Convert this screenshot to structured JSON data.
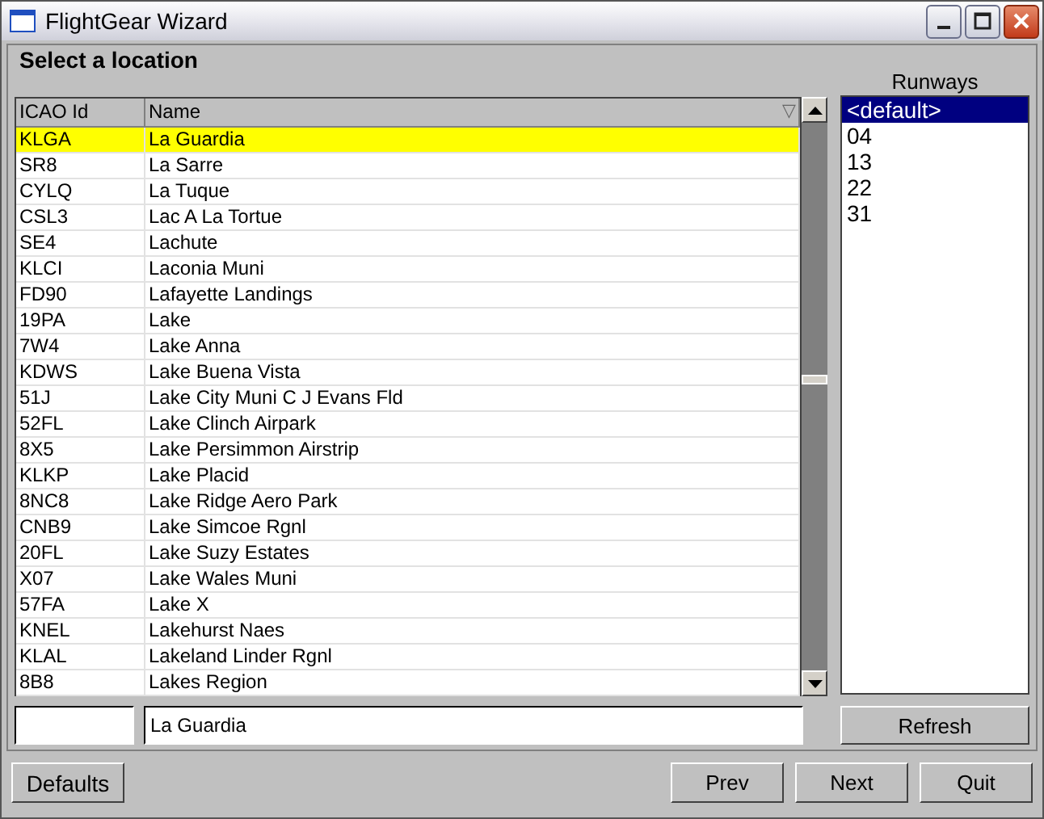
{
  "window": {
    "title": "FlightGear Wizard"
  },
  "heading": "Select a location",
  "table": {
    "columns": [
      "ICAO Id",
      "Name"
    ],
    "sort_indicator": "▽",
    "rows": [
      {
        "id": "KLGA",
        "name": "La Guardia",
        "selected": true
      },
      {
        "id": "SR8",
        "name": "La Sarre",
        "selected": false
      },
      {
        "id": "CYLQ",
        "name": "La Tuque",
        "selected": false
      },
      {
        "id": "CSL3",
        "name": "Lac A La Tortue",
        "selected": false
      },
      {
        "id": "SE4",
        "name": "Lachute",
        "selected": false
      },
      {
        "id": "KLCI",
        "name": "Laconia Muni",
        "selected": false
      },
      {
        "id": "FD90",
        "name": "Lafayette Landings",
        "selected": false
      },
      {
        "id": "19PA",
        "name": "Lake",
        "selected": false
      },
      {
        "id": "7W4",
        "name": "Lake Anna",
        "selected": false
      },
      {
        "id": "KDWS",
        "name": "Lake Buena Vista",
        "selected": false
      },
      {
        "id": "51J",
        "name": "Lake City Muni C J Evans Fld",
        "selected": false
      },
      {
        "id": "52FL",
        "name": "Lake Clinch Airpark",
        "selected": false
      },
      {
        "id": "8X5",
        "name": "Lake Persimmon Airstrip",
        "selected": false
      },
      {
        "id": "KLKP",
        "name": "Lake Placid",
        "selected": false
      },
      {
        "id": "8NC8",
        "name": "Lake Ridge Aero Park",
        "selected": false
      },
      {
        "id": "CNB9",
        "name": "Lake Simcoe Rgnl",
        "selected": false
      },
      {
        "id": "20FL",
        "name": "Lake Suzy Estates",
        "selected": false
      },
      {
        "id": "X07",
        "name": "Lake Wales Muni",
        "selected": false
      },
      {
        "id": "57FA",
        "name": "Lake X",
        "selected": false
      },
      {
        "id": "KNEL",
        "name": "Lakehurst Naes",
        "selected": false
      },
      {
        "id": "KLAL",
        "name": "Lakeland Linder Rgnl",
        "selected": false
      },
      {
        "id": "8B8",
        "name": "Lakes Region",
        "selected": false
      }
    ]
  },
  "runways": {
    "label": "Runways",
    "items": [
      {
        "label": "<default>",
        "selected": true
      },
      {
        "label": "04",
        "selected": false
      },
      {
        "label": "13",
        "selected": false
      },
      {
        "label": "22",
        "selected": false
      },
      {
        "label": "31",
        "selected": false
      }
    ]
  },
  "name_field": {
    "value": "La Guardia"
  },
  "refresh_button": "Refresh",
  "buttons": [
    "Defaults",
    "Prev",
    "Next",
    "Quit"
  ]
}
